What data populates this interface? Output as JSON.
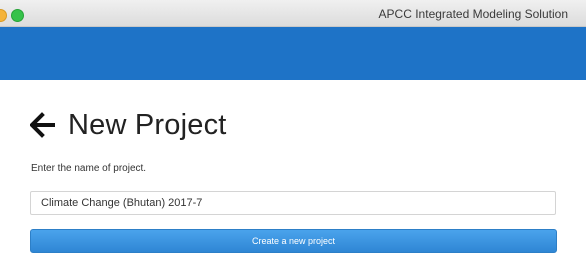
{
  "window": {
    "title": "APCC Integrated Modeling Solution"
  },
  "header": {
    "back_icon": "arrow-left-icon",
    "title": "New Project"
  },
  "form": {
    "prompt": "Enter the name of project.",
    "project_name_value": "Climate Change (Bhutan) 2017-7",
    "submit_label": "Create a new project"
  },
  "colors": {
    "banner": "#1e73c7",
    "button": "#3a92dd",
    "titlebar": "#e6e6e6"
  }
}
